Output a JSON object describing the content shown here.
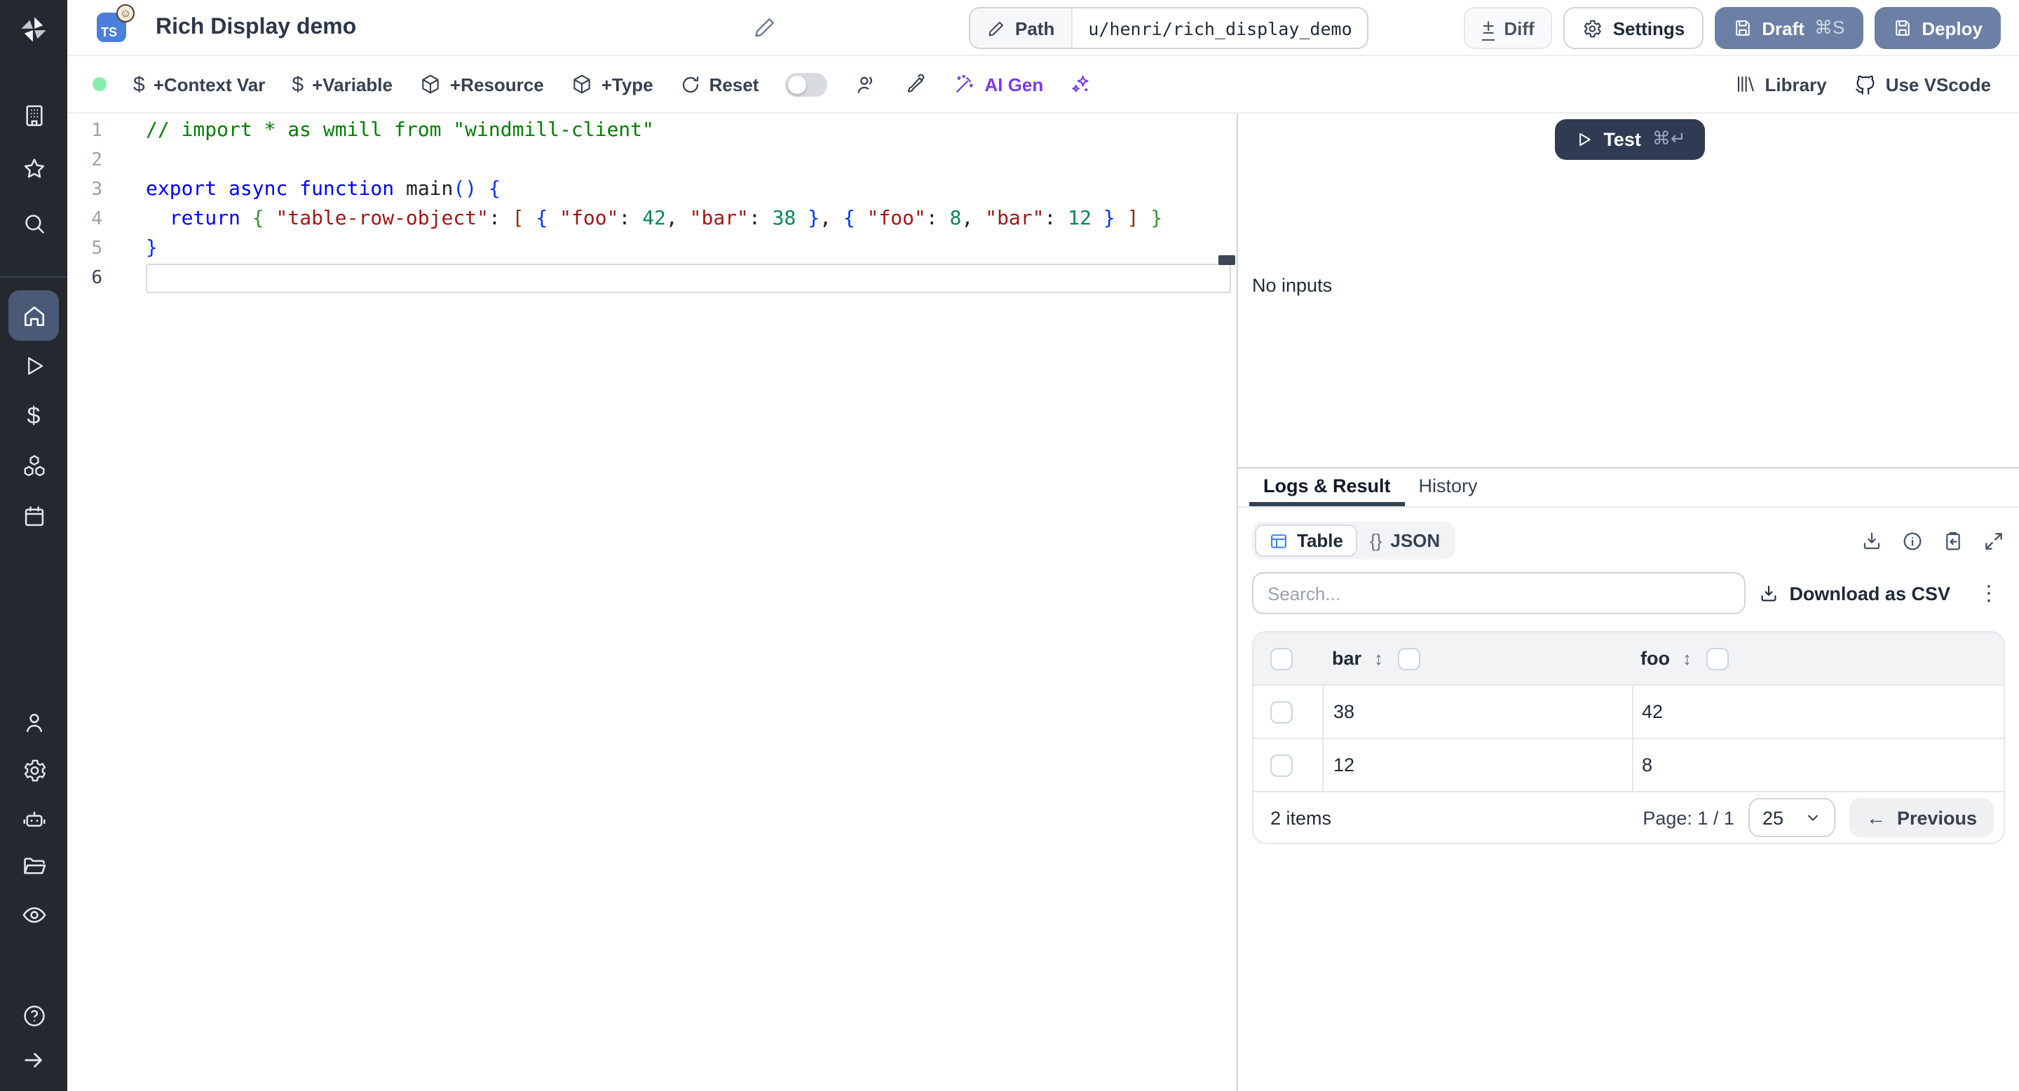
{
  "colors": {
    "sidebar_bg": "#24292f",
    "active_nav_bg": "#4a5975",
    "slate_button": "#6b80a4",
    "test_button": "#2e3b52",
    "ai_accent": "#7c3aed",
    "ts_badge_blue": "#4b7fd9",
    "status_green": "#86efac",
    "table_icon_blue": "#3b82f6",
    "tab_underline": "#334155"
  },
  "sidebar": {
    "icons": [
      "windmill-logo",
      "building",
      "star",
      "search",
      "home",
      "play",
      "dollar",
      "cubes",
      "calendar",
      "person",
      "gear",
      "robot",
      "folder",
      "eye",
      "help-circle",
      "arrow-right"
    ],
    "active_item": "home"
  },
  "header": {
    "lang_badge": "TS",
    "emoji_badge": "☺",
    "title": "Rich Display demo",
    "path_label": "Path",
    "path_value": "u/henri/rich_display_demo",
    "diff_label": "Diff",
    "diff_glyph": "±",
    "settings_label": "Settings",
    "draft_label": "Draft",
    "draft_shortcut": "⌘S",
    "deploy_label": "Deploy"
  },
  "toolbar": {
    "context_var": "+Context Var",
    "variable": "+Variable",
    "resource": "+Resource",
    "type": "+Type",
    "reset": "Reset",
    "dollar_glyph": "$",
    "ai_gen": "AI Gen",
    "library": "Library",
    "vscode": "Use VScode"
  },
  "editor": {
    "active_line": 6,
    "line_numbers": [
      1,
      2,
      3,
      4,
      5,
      6
    ],
    "lines": [
      [
        {
          "t": "// import * as wmill from \"windmill-client\"",
          "c": "comment"
        }
      ],
      [],
      [
        {
          "t": "export",
          "c": "kw"
        },
        {
          "t": " "
        },
        {
          "t": "async",
          "c": "kw"
        },
        {
          "t": " "
        },
        {
          "t": "function",
          "c": "kw"
        },
        {
          "t": " "
        },
        {
          "t": "main",
          "c": "fn"
        },
        {
          "t": "(",
          "c": "b1"
        },
        {
          "t": ")",
          "c": "b1"
        },
        {
          "t": " "
        },
        {
          "t": "{",
          "c": "b1"
        }
      ],
      [
        {
          "t": "  "
        },
        {
          "t": "return",
          "c": "kw"
        },
        {
          "t": " "
        },
        {
          "t": "{",
          "c": "b2"
        },
        {
          "t": " "
        },
        {
          "t": "\"table-row-object\"",
          "c": "str"
        },
        {
          "t": ": "
        },
        {
          "t": "[",
          "c": "b3"
        },
        {
          "t": " "
        },
        {
          "t": "{",
          "c": "b1"
        },
        {
          "t": " "
        },
        {
          "t": "\"foo\"",
          "c": "str"
        },
        {
          "t": ": "
        },
        {
          "t": "42",
          "c": "num"
        },
        {
          "t": ", "
        },
        {
          "t": "\"bar\"",
          "c": "str"
        },
        {
          "t": ": "
        },
        {
          "t": "38",
          "c": "num"
        },
        {
          "t": " "
        },
        {
          "t": "}",
          "c": "b1"
        },
        {
          "t": ", "
        },
        {
          "t": "{",
          "c": "b1"
        },
        {
          "t": " "
        },
        {
          "t": "\"foo\"",
          "c": "str"
        },
        {
          "t": ": "
        },
        {
          "t": "8",
          "c": "num"
        },
        {
          "t": ", "
        },
        {
          "t": "\"bar\"",
          "c": "str"
        },
        {
          "t": ": "
        },
        {
          "t": "12",
          "c": "num"
        },
        {
          "t": " "
        },
        {
          "t": "}",
          "c": "b1"
        },
        {
          "t": " "
        },
        {
          "t": "]",
          "c": "b3"
        },
        {
          "t": " "
        },
        {
          "t": "}",
          "c": "b2"
        }
      ],
      [
        {
          "t": "}",
          "c": "b1"
        }
      ],
      []
    ]
  },
  "run_panel": {
    "test_label": "Test",
    "test_shortcut": "⌘↵",
    "no_inputs": "No inputs"
  },
  "result_panel": {
    "tabs": [
      {
        "label": "Logs & Result",
        "active": true
      },
      {
        "label": "History",
        "active": false
      }
    ],
    "view_table": "Table",
    "view_json_prefix": "{}",
    "view_json": "JSON",
    "action_icons": [
      "download",
      "info",
      "clipboard-paste",
      "expand"
    ],
    "search_placeholder": "Search...",
    "download_csv": "Download as CSV",
    "kebab_glyph": "⋮",
    "table": {
      "columns": [
        "bar",
        "foo"
      ],
      "sort_glyph": "↕",
      "rows": [
        [
          "38",
          "42"
        ],
        [
          "12",
          "8"
        ]
      ],
      "items_text": "2 items",
      "page_text": "Page: 1 / 1",
      "page_size": "25",
      "prev_arrow": "←",
      "prev_label": "Previous"
    }
  }
}
